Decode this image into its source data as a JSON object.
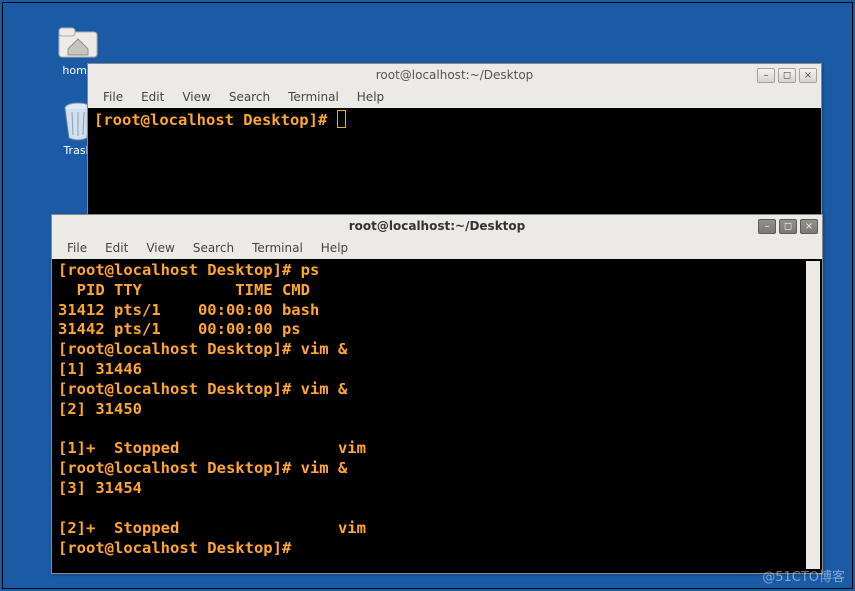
{
  "desktop": {
    "icons": [
      {
        "label": "home",
        "glyph": "home"
      },
      {
        "label": "Trash",
        "glyph": "trash"
      }
    ]
  },
  "watermark": "@51CTO博客",
  "windows": {
    "back": {
      "title": "root@localhost:~/Desktop",
      "menus": [
        "File",
        "Edit",
        "View",
        "Search",
        "Terminal",
        "Help"
      ],
      "prompt": "[root@localhost Desktop]# "
    },
    "front": {
      "title": "root@localhost:~/Desktop",
      "menus": [
        "File",
        "Edit",
        "View",
        "Search",
        "Terminal",
        "Help"
      ],
      "lines": [
        "[root@localhost Desktop]# ps",
        "  PID TTY          TIME CMD",
        "31412 pts/1    00:00:00 bash",
        "31442 pts/1    00:00:00 ps",
        "[root@localhost Desktop]# vim &",
        "[1] 31446",
        "[root@localhost Desktop]# vim &",
        "[2] 31450",
        "",
        "[1]+  Stopped                 vim",
        "[root@localhost Desktop]# vim &",
        "[3] 31454",
        "",
        "[2]+  Stopped                 vim",
        "[root@localhost Desktop]#"
      ]
    }
  }
}
